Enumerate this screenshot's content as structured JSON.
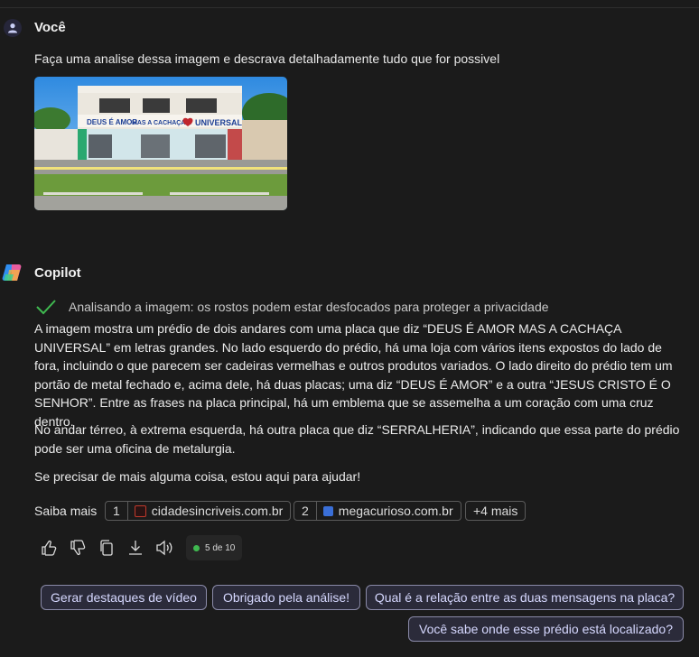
{
  "user": {
    "name": "Você",
    "message": "Faça uma analise dessa imagem e descrava detalhadamente tudo que for possivel"
  },
  "copilot": {
    "name": "Copilot",
    "status": "Analisando a imagem: os rostos podem estar desfocados para proteger a privacidade",
    "paragraphs": [
      "A imagem mostra um prédio de dois andares com uma placa que diz “DEUS É AMOR MAS A CACHAÇA UNIVERSAL” em letras grandes. No lado esquerdo do prédio, há uma loja com vários itens expostos do lado de fora, incluindo o que parecem ser cadeiras vermelhas e outros produtos variados. O lado direito do prédio tem um portão de metal fechado e, acima dele, há duas placas; uma diz “DEUS É AMOR” e a outra “JESUS CRISTO É O SENHOR”. Entre as frases na placa principal, há um emblema que se assemelha a um coração com uma cruz dentro.",
      "No andar térreo, à extrema esquerda, há outra placa que diz “SERRALHERIA”, indicando que essa parte do prédio pode ser uma oficina de metalurgia.",
      "Se precisar de mais alguma coisa, estou aqui para ajudar!"
    ]
  },
  "photo_signs": {
    "left": "DEUS É AMOR",
    "middle": "MAS A CACHAÇA É",
    "right": "UNIVERSAL"
  },
  "sources": {
    "label": "Saiba mais",
    "items": [
      {
        "num": "1",
        "domain": "cidadesincriveis.com.br",
        "color": "#c0392b"
      },
      {
        "num": "2",
        "domain": "megacurioso.com.br",
        "color": "#3a6fd8"
      }
    ],
    "more": "+4 mais"
  },
  "actions": {
    "counter": "5 de 10"
  },
  "suggestions": [
    "Gerar destaques de vídeo",
    "Obrigado pela análise!",
    "Qual é a relação entre as duas mensagens na placa?",
    "Você sabe onde esse prédio está localizado?"
  ]
}
